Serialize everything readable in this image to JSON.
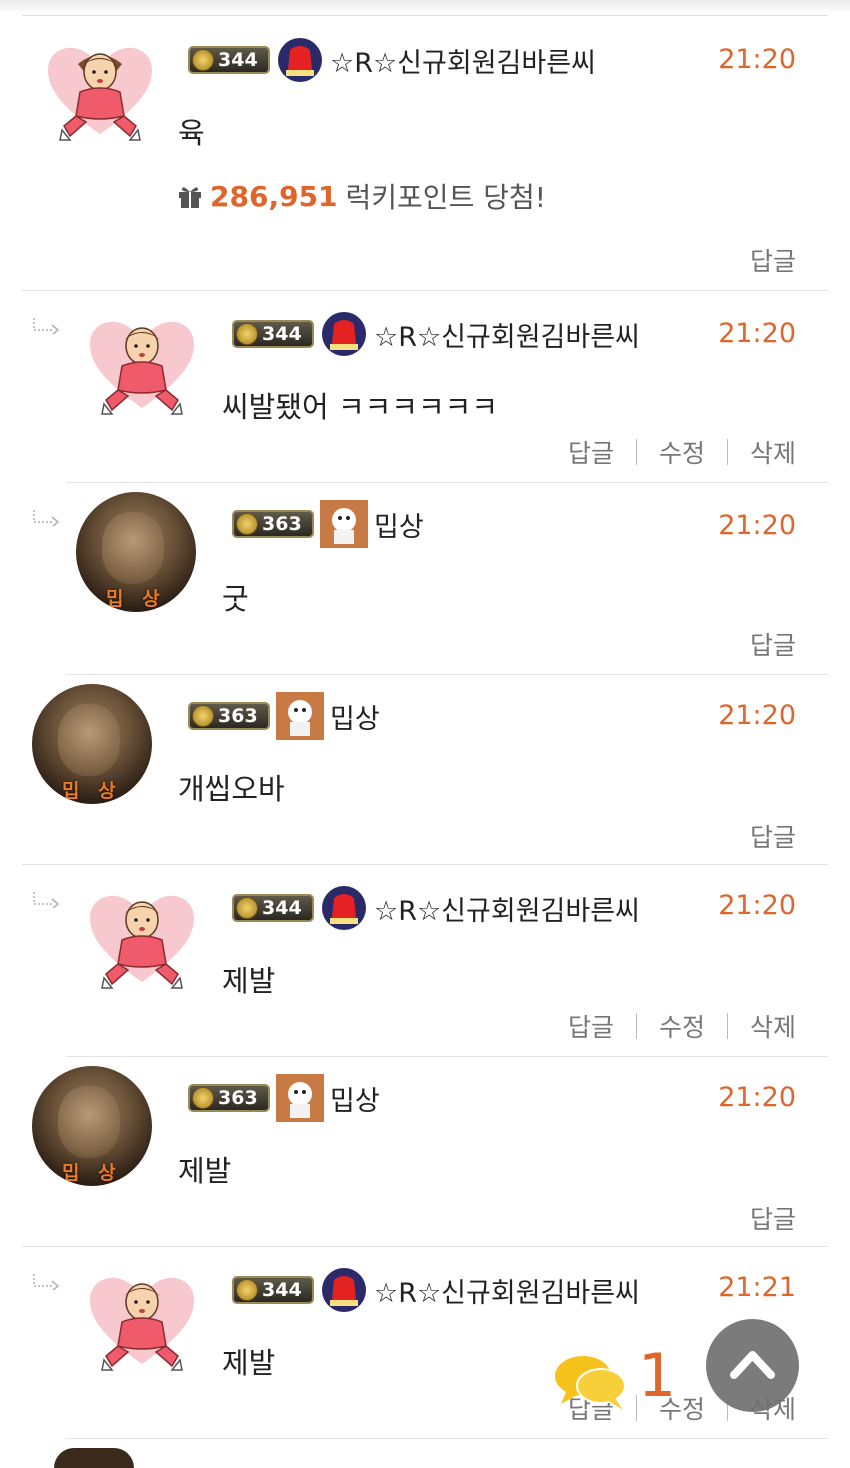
{
  "comments": [
    {
      "reply": false,
      "level": "344",
      "nick": "☆R☆신규회원김바른씨",
      "time": "21:20",
      "text": "육",
      "lucky_points": "286,951",
      "lucky_suffix": "럭키포인트 당첨!",
      "actions": [
        "답글"
      ],
      "avatar": "lady"
    },
    {
      "reply": true,
      "level": "344",
      "nick": "☆R☆신규회원김바른씨",
      "time": "21:20",
      "text": "씨발됐어 ㅋㅋㅋㅋㅋㅋ",
      "actions": [
        "답글",
        "수정",
        "삭제"
      ],
      "avatar": "lady"
    },
    {
      "reply": true,
      "level": "363",
      "nick": "밉상",
      "time": "21:20",
      "text": "굿",
      "actions": [
        "답글"
      ],
      "avatar": "man",
      "avatar_tag": "밉 상"
    },
    {
      "reply": false,
      "level": "363",
      "nick": "밉상",
      "time": "21:20",
      "text": "개씹오바",
      "actions": [
        "답글"
      ],
      "avatar": "man",
      "avatar_tag": "밉 상"
    },
    {
      "reply": true,
      "level": "344",
      "nick": "☆R☆신규회원김바른씨",
      "time": "21:20",
      "text": "제발",
      "actions": [
        "답글",
        "수정",
        "삭제"
      ],
      "avatar": "lady"
    },
    {
      "reply": false,
      "level": "363",
      "nick": "밉상",
      "time": "21:20",
      "text": "제발",
      "actions": [
        "답글"
      ],
      "avatar": "man",
      "avatar_tag": "밉 상"
    },
    {
      "reply": true,
      "level": "344",
      "nick": "☆R☆신규회원김바른씨",
      "time": "21:21",
      "text": "제발",
      "actions": [
        "답글",
        "수정",
        "삭제"
      ],
      "avatar": "lady"
    }
  ],
  "floating": {
    "chat_count": "1",
    "top_icon": "chevron-up-icon",
    "chat_icon": "chat-bubbles-icon"
  },
  "colors": {
    "accent": "#e0652a",
    "divider": "#e2e2e2",
    "float_button": "#707070"
  }
}
